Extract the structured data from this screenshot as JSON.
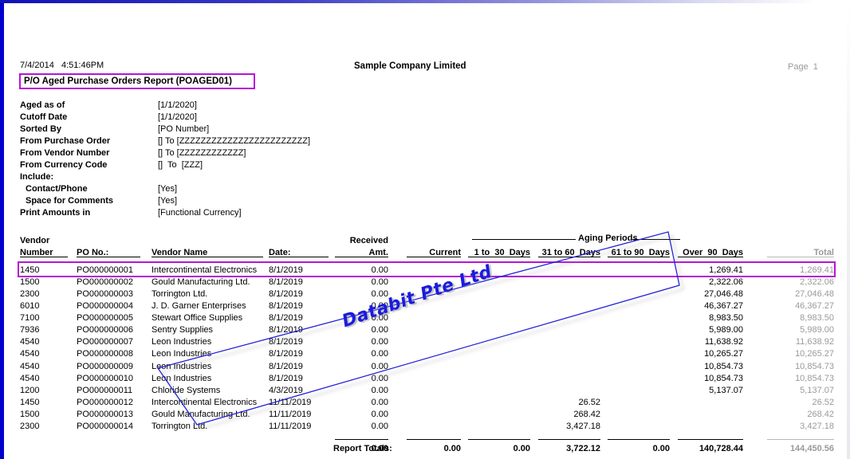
{
  "window": {
    "accent_border_color": "#0000cc",
    "highlight_color": "#b415d6"
  },
  "header": {
    "print_datetime": "7/4/2014   4:51:46PM",
    "company": "Sample Company Limited",
    "page_label": "Page  1",
    "report_title": "P/O Aged Purchase Orders Report (POAGED01)"
  },
  "criteria": [
    {
      "label": "Aged as of",
      "value": "[1/1/2020]"
    },
    {
      "label": "Cutoff Date",
      "value": "[1/1/2020]"
    },
    {
      "label": "Sorted By",
      "value": "[PO Number]"
    },
    {
      "label": "From Purchase Order",
      "value": "[] To [ZZZZZZZZZZZZZZZZZZZZZZZZ]"
    },
    {
      "label": "From Vendor Number",
      "value": "[] To [ZZZZZZZZZZZZ]"
    },
    {
      "label": "From Currency Code",
      "value": "[]  To  [ZZZ]"
    },
    {
      "label": "Include:",
      "value": ""
    },
    {
      "label": "Contact/Phone",
      "value": "[Yes]",
      "indent": true
    },
    {
      "label": "Space for Comments",
      "value": "[Yes]",
      "indent": true
    },
    {
      "label": "Print Amounts in",
      "value": "[Functional Currency]"
    }
  ],
  "table": {
    "group_heading": "Aging Periods",
    "columns": [
      {
        "key": "vendor_number",
        "line1": "Vendor",
        "line2": "Number"
      },
      {
        "key": "po_no",
        "line1": "",
        "line2": "PO No.:"
      },
      {
        "key": "vendor_name",
        "line1": "",
        "line2": "Vendor Name"
      },
      {
        "key": "date",
        "line1": "",
        "line2": "Date:"
      },
      {
        "key": "received_amt",
        "line1": "Received",
        "line2": "Amt."
      },
      {
        "key": "current",
        "line1": "",
        "line2": "Current"
      },
      {
        "key": "d1_30",
        "line1": "",
        "line2": "1 to  30  Days"
      },
      {
        "key": "d31_60",
        "line1": "",
        "line2": "31 to 60  Days"
      },
      {
        "key": "d61_90",
        "line1": "",
        "line2": "61 to 90  Days"
      },
      {
        "key": "over90",
        "line1": "",
        "line2": "Over  90  Days"
      },
      {
        "key": "total",
        "line1": "",
        "line2": "Total"
      }
    ],
    "rows": [
      {
        "vendor_number": "1450",
        "po_no": "PO000000001",
        "vendor_name": "Intercontinental Electronics",
        "date": "8/1/2019",
        "received_amt": "0.00",
        "current": "",
        "d1_30": "",
        "d31_60": "",
        "d61_90": "",
        "over90": "1,269.41",
        "total": "1,269.41",
        "highlighted": true
      },
      {
        "vendor_number": "1500",
        "po_no": "PO000000002",
        "vendor_name": "Gould Manufacturing Ltd.",
        "date": "8/1/2019",
        "received_amt": "0.00",
        "current": "",
        "d1_30": "",
        "d31_60": "",
        "d61_90": "",
        "over90": "2,322.06",
        "total": "2,322.06"
      },
      {
        "vendor_number": "2300",
        "po_no": "PO000000003",
        "vendor_name": "Torrington Ltd.",
        "date": "8/1/2019",
        "received_amt": "0.00",
        "current": "",
        "d1_30": "",
        "d31_60": "",
        "d61_90": "",
        "over90": "27,046.48",
        "total": "27,046.48"
      },
      {
        "vendor_number": "6010",
        "po_no": "PO000000004",
        "vendor_name": "J. D. Garner Enterprises",
        "date": "8/1/2019",
        "received_amt": "0.00",
        "current": "",
        "d1_30": "",
        "d31_60": "",
        "d61_90": "",
        "over90": "46,367.27",
        "total": "46,367.27"
      },
      {
        "vendor_number": "7100",
        "po_no": "PO000000005",
        "vendor_name": "Stewart Office Supplies",
        "date": "8/1/2019",
        "received_amt": "0.00",
        "current": "",
        "d1_30": "",
        "d31_60": "",
        "d61_90": "",
        "over90": "8,983.50",
        "total": "8,983.50"
      },
      {
        "vendor_number": "7936",
        "po_no": "PO000000006",
        "vendor_name": "Sentry Supplies",
        "date": "8/1/2019",
        "received_amt": "0.00",
        "current": "",
        "d1_30": "",
        "d31_60": "",
        "d61_90": "",
        "over90": "5,989.00",
        "total": "5,989.00"
      },
      {
        "vendor_number": "4540",
        "po_no": "PO000000007",
        "vendor_name": "Leon Industries",
        "date": "8/1/2019",
        "received_amt": "0.00",
        "current": "",
        "d1_30": "",
        "d31_60": "",
        "d61_90": "",
        "over90": "11,638.92",
        "total": "11,638.92"
      },
      {
        "vendor_number": "4540",
        "po_no": "PO000000008",
        "vendor_name": "Leon Industries",
        "date": "8/1/2019",
        "received_amt": "0.00",
        "current": "",
        "d1_30": "",
        "d31_60": "",
        "d61_90": "",
        "over90": "10,265.27",
        "total": "10,265.27"
      },
      {
        "vendor_number": "4540",
        "po_no": "PO000000009",
        "vendor_name": "Leon Industries",
        "date": "8/1/2019",
        "received_amt": "0.00",
        "current": "",
        "d1_30": "",
        "d31_60": "",
        "d61_90": "",
        "over90": "10,854.73",
        "total": "10,854.73"
      },
      {
        "vendor_number": "4540",
        "po_no": "PO000000010",
        "vendor_name": "Leon Industries",
        "date": "8/1/2019",
        "received_amt": "0.00",
        "current": "",
        "d1_30": "",
        "d31_60": "",
        "d61_90": "",
        "over90": "10,854.73",
        "total": "10,854.73"
      },
      {
        "vendor_number": "1200",
        "po_no": "PO000000011",
        "vendor_name": "Chloride Systems",
        "date": "4/3/2019",
        "received_amt": "0.00",
        "current": "",
        "d1_30": "",
        "d31_60": "",
        "d61_90": "",
        "over90": "5,137.07",
        "total": "5,137.07"
      },
      {
        "vendor_number": "1450",
        "po_no": "PO000000012",
        "vendor_name": "Intercontinental Electronics",
        "date": "11/11/2019",
        "received_amt": "0.00",
        "current": "",
        "d1_30": "",
        "d31_60": "26.52",
        "d61_90": "",
        "over90": "",
        "total": "26.52"
      },
      {
        "vendor_number": "1500",
        "po_no": "PO000000013",
        "vendor_name": "Gould Manufacturing Ltd.",
        "date": "11/11/2019",
        "received_amt": "0.00",
        "current": "",
        "d1_30": "",
        "d31_60": "268.42",
        "d61_90": "",
        "over90": "",
        "total": "268.42"
      },
      {
        "vendor_number": "2300",
        "po_no": "PO000000014",
        "vendor_name": "Torrington Ltd.",
        "date": "11/11/2019",
        "received_amt": "0.00",
        "current": "",
        "d1_30": "",
        "d31_60": "3,427.18",
        "d61_90": "",
        "over90": "",
        "total": "3,427.18"
      }
    ],
    "totals": {
      "label": "Report Totals:",
      "received_amt": "0.00",
      "current": "0.00",
      "d1_30": "0.00",
      "d31_60": "3,722.12",
      "d61_90": "0.00",
      "over90": "140,728.44",
      "total": "144,450.56"
    }
  },
  "watermark": {
    "text": "Databit Pte Ltd",
    "color": "#1a1ae0"
  }
}
